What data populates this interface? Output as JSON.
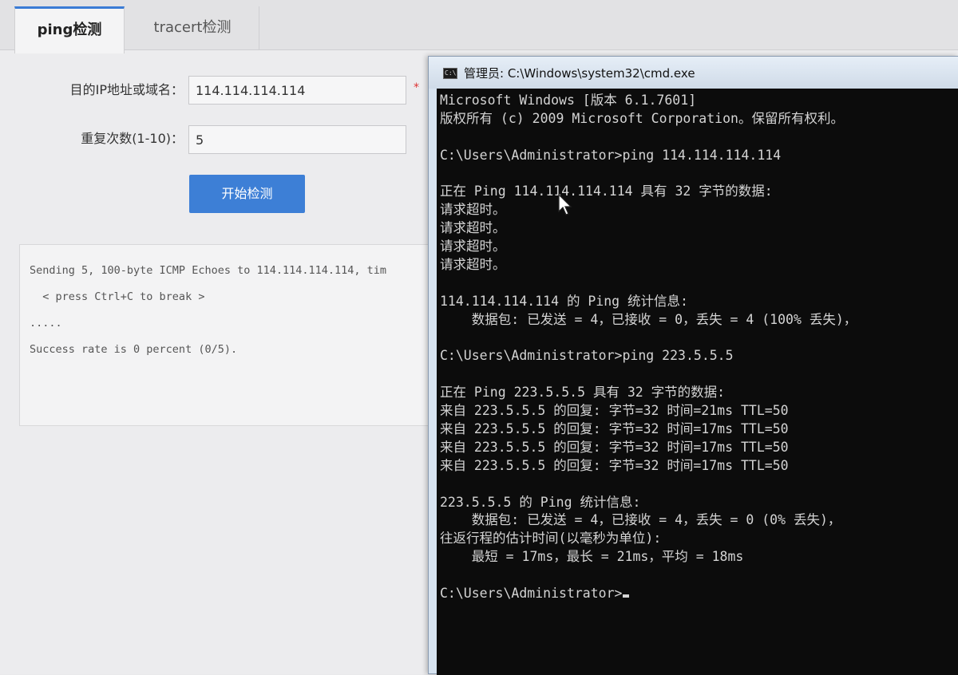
{
  "tabs": [
    {
      "label": "ping检测",
      "active": true
    },
    {
      "label": "tracert检测",
      "active": false
    }
  ],
  "form": {
    "target_label": "目的IP地址或域名：",
    "target_value": "114.114.114.114",
    "required_mark": "*",
    "repeat_label": "重复次数(1-10)：",
    "repeat_value": "5",
    "start_button": "开始检测"
  },
  "result": {
    "lines": [
      "Sending 5, 100-byte ICMP Echoes to 114.114.114.114, tim",
      "  < press Ctrl+C to break >",
      ".....",
      "Success rate is 0 percent (0/5)."
    ]
  },
  "cmd": {
    "title": "管理员: C:\\Windows\\system32\\cmd.exe",
    "icon_text": "C:\\",
    "lines": [
      "Microsoft Windows [版本 6.1.7601]",
      "版权所有 (c) 2009 Microsoft Corporation。保留所有权利。",
      "",
      "C:\\Users\\Administrator>ping 114.114.114.114",
      "",
      "正在 Ping 114.114.114.114 具有 32 字节的数据:",
      "请求超时。",
      "请求超时。",
      "请求超时。",
      "请求超时。",
      "",
      "114.114.114.114 的 Ping 统计信息:",
      "    数据包: 已发送 = 4，已接收 = 0，丢失 = 4 (100% 丢失)，",
      "",
      "C:\\Users\\Administrator>ping 223.5.5.5",
      "",
      "正在 Ping 223.5.5.5 具有 32 字节的数据:",
      "来自 223.5.5.5 的回复: 字节=32 时间=21ms TTL=50",
      "来自 223.5.5.5 的回复: 字节=32 时间=17ms TTL=50",
      "来自 223.5.5.5 的回复: 字节=32 时间=17ms TTL=50",
      "来自 223.5.5.5 的回复: 字节=32 时间=17ms TTL=50",
      "",
      "223.5.5.5 的 Ping 统计信息:",
      "    数据包: 已发送 = 4，已接收 = 4，丢失 = 0 (0% 丢失)，",
      "往返行程的估计时间(以毫秒为单位):",
      "    最短 = 17ms，最长 = 21ms，平均 = 18ms",
      "",
      "C:\\Users\\Administrator>"
    ]
  },
  "colors": {
    "accent": "#3d7fd6",
    "required": "#dd3333",
    "console_bg": "#0c0c0c",
    "console_fg": "#d4d4d4"
  }
}
